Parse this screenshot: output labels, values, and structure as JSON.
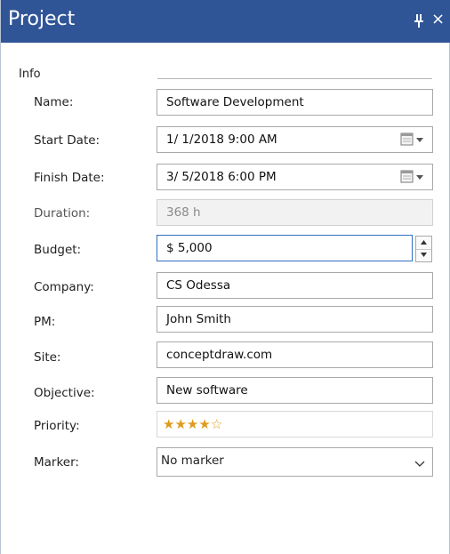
{
  "panel": {
    "title": "Project",
    "close_glyph": "×"
  },
  "info": {
    "section_label": "Info",
    "name": {
      "label": "Name:",
      "value": "Software Development"
    },
    "start_date": {
      "label": "Start Date:",
      "value": "1/  1/2018   9:00 AM"
    },
    "finish_date": {
      "label": "Finish Date:",
      "value": "3/  5/2018   6:00 PM"
    },
    "duration": {
      "label": "Duration:",
      "value": "368 h"
    },
    "budget": {
      "label": "Budget:",
      "value": "$ 5,000"
    },
    "company": {
      "label": "Company:",
      "value": "CS Odessa"
    },
    "pm": {
      "label": "PM:",
      "value": "John Smith"
    },
    "site": {
      "label": "Site:",
      "value": "conceptdraw.com"
    },
    "objective": {
      "label": "Objective:",
      "value": "New software"
    },
    "priority": {
      "label": "Priority:",
      "rating": 4,
      "max_rating": 5,
      "stars": [
        "★",
        "★",
        "★",
        "★",
        "☆"
      ]
    },
    "marker": {
      "label": "Marker:",
      "value": "No marker"
    }
  },
  "icons": {
    "pin": "pin-icon",
    "close": "close-icon",
    "calendar": "calendar-dropdown-icon",
    "spin_up": "spin-up-icon",
    "spin_down": "spin-down-icon",
    "chevron": "chevron-down-icon"
  },
  "colors": {
    "titlebar": "#2f5597",
    "focus_border": "#2f6fc4",
    "star": "#e09a1c"
  }
}
